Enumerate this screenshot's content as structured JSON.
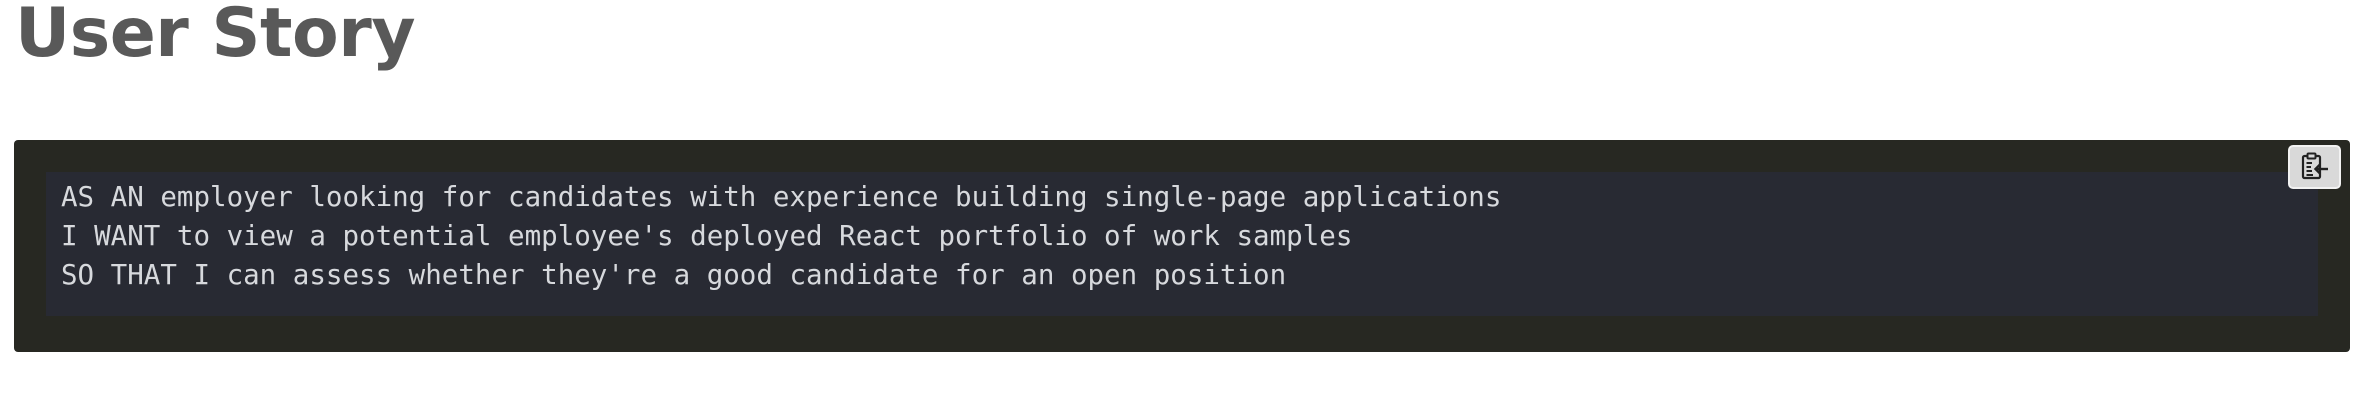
{
  "page": {
    "title": "User Story"
  },
  "code_block": {
    "lines": [
      "AS AN employer looking for candidates with experience building single-page applications",
      "I WANT to view a potential employee's deployed React portfolio of work samples",
      "SO THAT I can assess whether they're a good candidate for an open position"
    ],
    "copy_button": {
      "icon": "clipboard-copy-icon"
    }
  },
  "colors": {
    "title": "#595959",
    "code_outer_bg": "#272822",
    "code_inner_bg": "#282a33",
    "code_text": "#d7d9dd",
    "copy_button_bg": "#d9d9d9"
  }
}
